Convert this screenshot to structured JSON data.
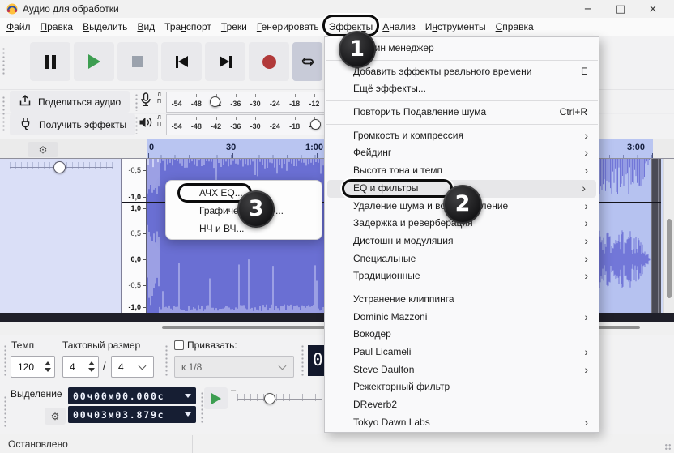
{
  "window": {
    "title": "Аудио для обработки"
  },
  "icons": {
    "gear": "⚙",
    "minimize": "−",
    "maximize": "□",
    "close": "×",
    "minus": "–",
    "slash": "/"
  },
  "menubar": {
    "items": [
      {
        "pre": "",
        "key": "Ф",
        "post": "айл"
      },
      {
        "pre": "",
        "key": "П",
        "post": "равка"
      },
      {
        "pre": "",
        "key": "В",
        "post": "ыделить"
      },
      {
        "pre": "",
        "key": "В",
        "post": "ид"
      },
      {
        "pre": "Тра",
        "key": "н",
        "post": "спорт"
      },
      {
        "pre": "",
        "key": "Т",
        "post": "реки"
      },
      {
        "pre": "",
        "key": "Г",
        "post": "енерировать"
      },
      {
        "pre": "Эффек",
        "key": "т",
        "post": "ы"
      },
      {
        "pre": "",
        "key": "А",
        "post": "нализ"
      },
      {
        "pre": "И",
        "key": "н",
        "post": "струменты"
      },
      {
        "pre": "",
        "key": "С",
        "post": "правка"
      }
    ]
  },
  "transport_icons": [
    "pause",
    "play",
    "stop",
    "skip-to-start",
    "skip-to-end",
    "record",
    "loop"
  ],
  "share_toolbar": {
    "share_audio": "Поделиться аудио",
    "get_effects": "Получить эффекты"
  },
  "meters": {
    "channel_left": "Л",
    "channel_right": "П",
    "scale": [
      "-54",
      "-48",
      "-42",
      "-36",
      "-30",
      "-24",
      "-18",
      "-12"
    ]
  },
  "timeline": {
    "marks": [
      "0",
      "30",
      "1:00",
      "3:00"
    ]
  },
  "track": {
    "ruler": [
      "-0,5",
      "-1,0",
      "1,0",
      "0,5",
      "0,0",
      "-0,5",
      "-1,0"
    ]
  },
  "effects_menu": {
    "items": [
      {
        "label": "Плагин менеджер"
      },
      {
        "label": "Добавить эффекты реального времени",
        "shortcut": "E"
      },
      {
        "label": "Ещё эффекты..."
      },
      {
        "label": "Повторить Подавление шума",
        "shortcut": "Ctrl+R"
      },
      {
        "label": "Громкость и компрессия"
      },
      {
        "label": "Фейдинг"
      },
      {
        "label": "Высота тона и темп"
      },
      {
        "label": "EQ и фильтры"
      },
      {
        "label": "Удаление шума и восстановление"
      },
      {
        "label": "Задержка и реверберация"
      },
      {
        "label": "Дистошн и модуляция"
      },
      {
        "label": "Специальные"
      },
      {
        "label": "Традиционные"
      },
      {
        "label": "Устранение клиппинга"
      },
      {
        "label": "Dominic Mazzoni"
      },
      {
        "label": "Вокодер"
      },
      {
        "label": "Paul Licameli"
      },
      {
        "label": "Steve Daulton"
      },
      {
        "label": "Режекторный фильтр"
      },
      {
        "label": "DReverb2"
      },
      {
        "label": "Tokyo Dawn Labs"
      }
    ]
  },
  "eq_submenu": {
    "items": [
      {
        "label": "АЧХ EQ..."
      },
      {
        "label": "Графический EQ..."
      },
      {
        "label": "НЧ и ВЧ..."
      }
    ]
  },
  "tempo": {
    "label": "Темп",
    "value": "120"
  },
  "time_signature": {
    "label": "Тактовый размер",
    "upper": "4",
    "lower": "4"
  },
  "snap": {
    "label": "Привязать:",
    "value": "к 1/8"
  },
  "time_toolbar": {
    "partial_digit": "0"
  },
  "selection": {
    "label": "Выделение",
    "start": "00ч00м00.000с",
    "end": "00ч03м03.879с"
  },
  "status": {
    "text": "Остановлено"
  },
  "annotations": {
    "step1": "1",
    "step2": "2",
    "step3": "3"
  },
  "colors": {
    "play_green": "#3d9e51",
    "record_red": "#b13a3a",
    "selected_wave_bg": "#6a6fd3",
    "wave_spike": "#cdd1f5",
    "unselected_wave_bg": "#b6c2f0",
    "unselected_wave": "#7277d8",
    "timeline_selected": "#b9c5f1",
    "time_display_bg": "#161e33"
  }
}
